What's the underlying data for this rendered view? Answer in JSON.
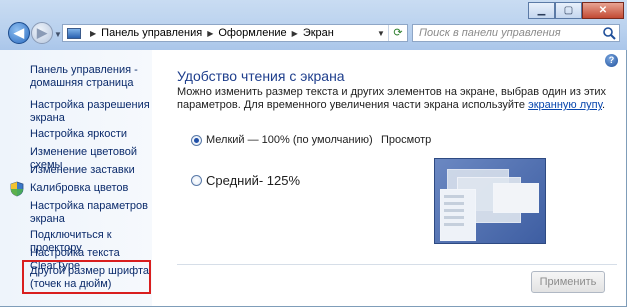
{
  "window": {
    "minimize_label": "▁",
    "maximize_label": "▢",
    "close_label": "✕"
  },
  "nav": {
    "back_label": "◀",
    "forward_label": "▶"
  },
  "breadcrumb": [
    "Панель управления",
    "Оформление",
    "Экран"
  ],
  "search": {
    "placeholder": "Поиск в панели управления"
  },
  "sidebar": {
    "items": [
      {
        "label": "Панель управления -\nдомашняя страница"
      },
      {
        "label": "Настройка разрешения\nэкрана"
      },
      {
        "label": "Настройка яркости"
      },
      {
        "label": "Изменение цветовой схемы"
      },
      {
        "label": "Изменение заставки"
      },
      {
        "label": "Калибровка цветов",
        "icon": "shield-icon"
      },
      {
        "label": "Настройка параметров\nэкрана"
      },
      {
        "label": "Подключиться к проектору"
      },
      {
        "label": "Настройка текста ClearType"
      },
      {
        "label": "Другой размер шрифта\n(точек на дюйм)",
        "highlighted": true
      }
    ]
  },
  "main": {
    "title": "Удобство чтения с экрана",
    "description": "Можно изменить размер текста и других элементов на экране, выбрав один из этих параметров. Для временного увеличения части экрана используйте ",
    "description_link": "экранную лупу",
    "description_end": ".",
    "options": [
      {
        "label": "Мелкий — 100% (по умолчанию)",
        "selected": true
      },
      {
        "label": "Средний- 125%",
        "selected": false
      }
    ],
    "preview_label": "Просмотр",
    "apply_button": "Применить"
  },
  "colors": {
    "link": "#0b2b6b",
    "title": "#1e3e8c",
    "highlight_border": "#d91e1e"
  }
}
